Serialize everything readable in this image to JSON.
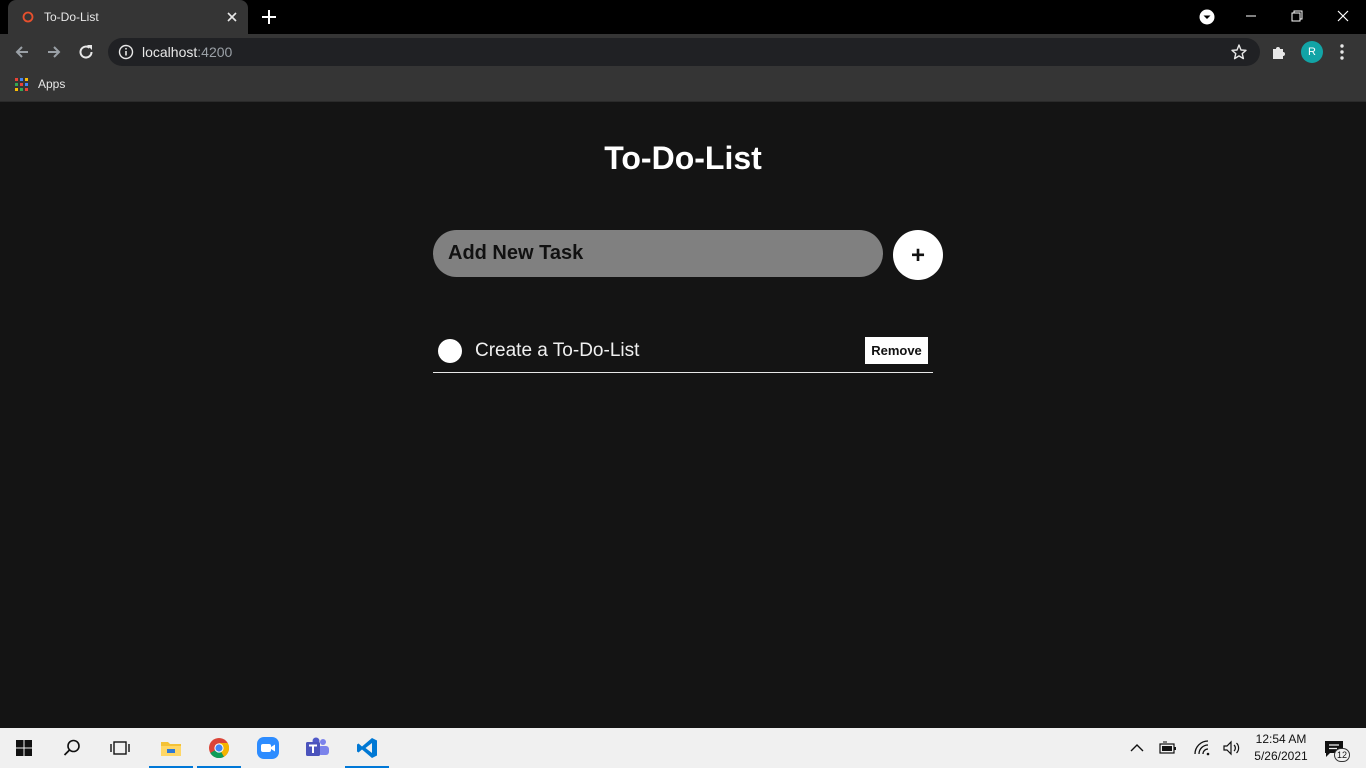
{
  "browser": {
    "tab_title": "To-Do-List",
    "url_host": "localhost",
    "url_port": ":4200",
    "bookmarks": {
      "apps_label": "Apps"
    },
    "profile_initial": "R"
  },
  "app": {
    "title": "To-Do-List",
    "input_placeholder": "Add New Task",
    "add_label": "+",
    "tasks": [
      {
        "text": "Create a To-Do-List",
        "remove_label": "Remove"
      }
    ]
  },
  "taskbar": {
    "time": "12:54 AM",
    "date": "5/26/2021",
    "notification_count": "12"
  },
  "colors": {
    "page_background": "#141414",
    "input_background": "#808080",
    "avatar": "#12a4a6",
    "taskbar_accent": "#0078d7"
  },
  "icons": {
    "tab": [
      "angular-favicon-icon",
      "close-icon",
      "plus-icon"
    ],
    "toolbar": [
      "back-arrow-icon",
      "forward-arrow-icon",
      "reload-icon",
      "info-icon",
      "star-icon",
      "puzzle-icon",
      "kebab-menu-icon"
    ],
    "taskbar": [
      "windows-start-icon",
      "search-icon",
      "task-view-icon",
      "file-explorer-icon",
      "chrome-icon",
      "zoom-icon",
      "teams-icon",
      "vscode-icon"
    ]
  }
}
